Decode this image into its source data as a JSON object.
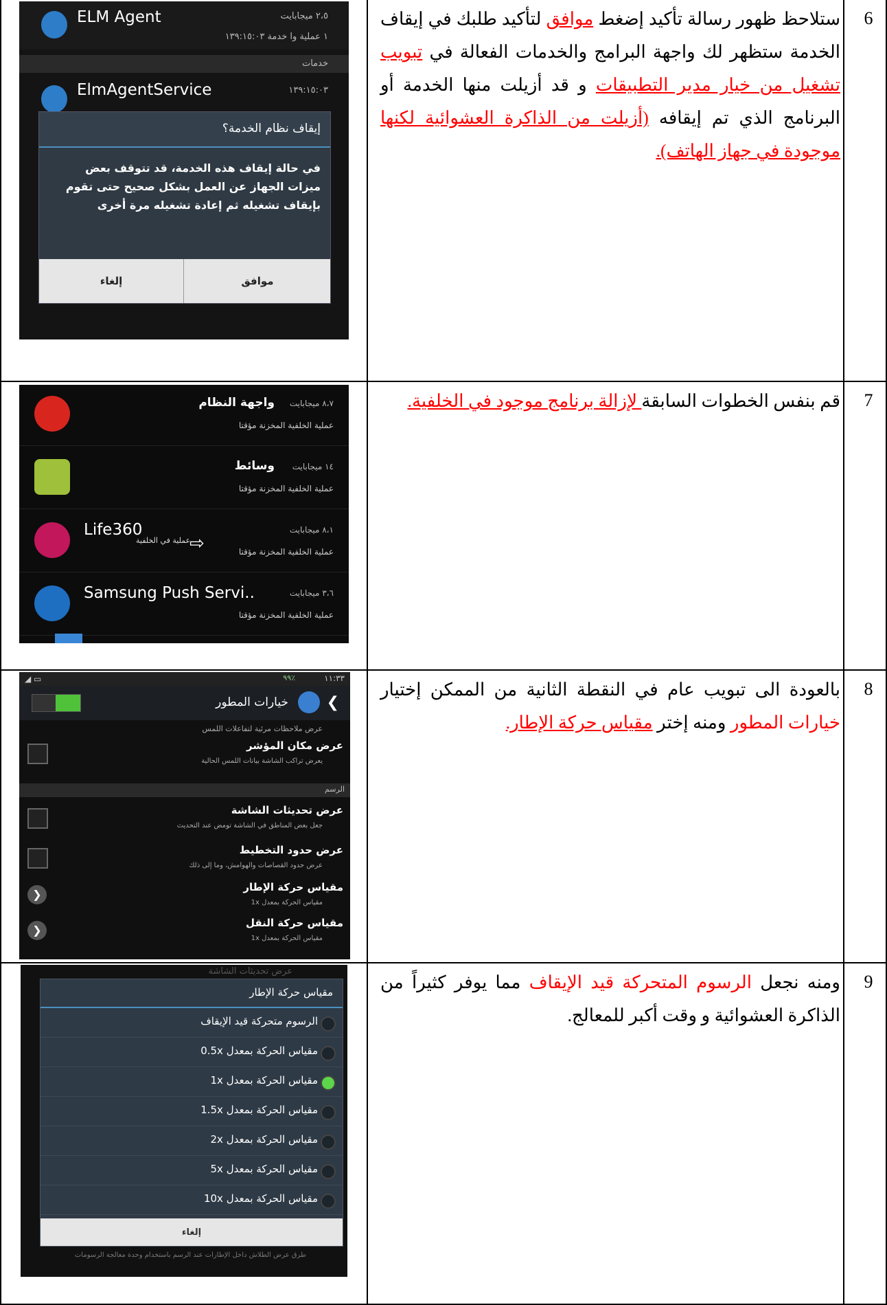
{
  "rows": [
    {
      "num": "6",
      "t1": "ستلاحظ ظهور رسالة تأكيد إضغط ",
      "t2": "موافق",
      "t3": " لتأكيد طلبك في إيقاف الخدمة ستظهر لك واجهة البرامج والخدمات الفعالة في ",
      "t4": "تبويب تشغيل من خيار مدير التطبيقات",
      "t5": " و قد أزيلت منها الخدمة أو البرنامج الذي تم إيقافه ",
      "t6": "(أزيلت من الذاكرة العشوائية لكنها موجودة في جهاز الهاتف).",
      "shot": {
        "app1": "ELM Agent",
        "app1_size": "٢،٥ ميجابايت",
        "app1_sub": "١ عملية وا خدمة  ١٣٩:١٥:٠٣",
        "section": "خدمات",
        "app2": "ElmAgentService",
        "app2_time": "١٣٩:١٥:٠٣",
        "dialog_title": "إيقاف نظام الخدمة؟",
        "dialog_body": "في حالة إيقاف هذه الخدمة، قد تتوقف بعض ميزات الجهاز عن العمل بشكل صحيح حتى تقوم بإيقاف تشغيله ثم إعادة تشغيله مرة أخرى",
        "ok": "موافق",
        "cancel": "إلغاء"
      }
    },
    {
      "num": "7",
      "t1": "قم بنفس الخطوات السابقة",
      "t2": " لإزالة برنامج موجود في الخلفية.",
      "shot": {
        "items": [
          {
            "name": "واجهة النظام",
            "size": "٨،٧ ميجابايت",
            "sub": "عملية الخلفية المخزنة مؤقتا",
            "icon": "jellybean-icon",
            "color": "#d8261f"
          },
          {
            "name": "وسائط",
            "size": "١٤ ميجابايت",
            "sub": "عملية الخلفية المخزنة مؤقتا",
            "icon": "android-icon",
            "color": "#9fc03a"
          },
          {
            "name": "Life360",
            "size": "٨،١ ميجابايت",
            "sub": "عملية الخلفية المخزنة مؤقتا",
            "icon": "life360-icon",
            "color": "#c2185b"
          },
          {
            "name": "Samsung Push Servi..",
            "size": "٣،٦ ميجابايت",
            "sub": "عملية الخلفية المخزنة مؤقتا",
            "icon": "samsung-push-icon",
            "color": "#1e6fc2"
          }
        ],
        "annotation": "عملية في الخلفية"
      }
    },
    {
      "num": "8",
      "t1": "بالعودة الى تبويب عام في النقطة الثانية من الممكن إختيار ",
      "t2": "خيارات المطور",
      "t3": " ومنه إختر ",
      "t4": "مقياس حركة الإطار.",
      "shot": {
        "time": "١١:٣٣",
        "battery": "٩٩٪",
        "header": "خيارات المطور",
        "top_hint": "عرض ملاحظات مرئية لتفاعلات اللمس",
        "items": [
          {
            "title": "عرض مكان المؤشر",
            "sub": "يعرض تراكب الشاشة بيانات اللمس الحالية",
            "kind": "check"
          },
          {
            "title": "عرض تحديثات الشاشة",
            "sub": "جعل بعض المناطق في الشاشة تومض عند التحديث",
            "kind": "check"
          },
          {
            "title": "عرض حدود التخطيط",
            "sub": "عرض حدود القصاصات والهوامش، وما إلى ذلك",
            "kind": "check"
          },
          {
            "title": "مقياس حركة الإطار",
            "sub": "مقياس الحركة بمعدل 1x",
            "kind": "arrow"
          },
          {
            "title": "مقياس حركة النقل",
            "sub": "مقياس الحركة بمعدل 1x",
            "kind": "arrow"
          }
        ],
        "section": "الرسم"
      }
    },
    {
      "num": "9",
      "t1": "ومنه نجعل ",
      "t2": "الرسوم المتحركة قيد الإيقاف",
      "t3": " مما يوفر كثيراً من الذاكرة العشوائية و وقت أكبر للمعالج.",
      "shot": {
        "bg_title": "عرض تحديثات الشاشة",
        "title": "مقياس حركة الإطار",
        "options": [
          "الرسوم متحركة قيد الإيقاف",
          "مقياس الحركة بمعدل 0.5x",
          "مقياس الحركة بمعدل 1x",
          "مقياس الحركة بمعدل 1.5x",
          "مقياس الحركة بمعدل 2x",
          "مقياس الحركة بمعدل 5x",
          "مقياس الحركة بمعدل 10x"
        ],
        "selected": 2,
        "cancel": "إلغاء",
        "bottom": "طرق عرض الطلاش داخل الإطارات عند الرسم باستخدام وحدة معالجة الرسومات"
      }
    }
  ]
}
